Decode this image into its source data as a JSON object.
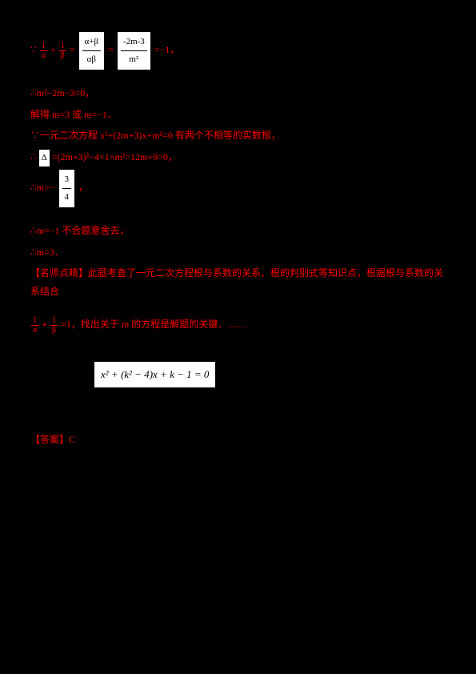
{
  "line1_prefix": "∵",
  "frac1_num": "1",
  "frac1_den": "α",
  "plus": "+",
  "frac2_num": "1",
  "frac2_den": "β",
  "eq": "=",
  "frac3a_num": "α+β",
  "frac3a_den": "αβ",
  "frac3b_num": "-2m-3",
  "frac3b_den": "m²",
  "line1_suffix": "=−1，",
  "line2": "∴m²−2m−3=0，",
  "line3": "解得 m=3 或 m=−1．",
  "line4": "∵一元二次方程 x²+(2m+3)x+m²=0 有两个不相等的实数根，",
  "line5_prefix": "∴",
  "delta_label": "Δ",
  "line5_suffix": "=(2m+3)²−4×1×m²=12m+9>0，",
  "line6_prefix": "∴m>−",
  "frac4_num": "3",
  "frac4_den": "4",
  "line6_suffix": "，",
  "line7": "∴m=−1 不合题意舍去，",
  "line8": "∴m=3．",
  "line9": "【名师点睛】此题考查了一元二次方程根与系数的关系、根的判别式等知识点，根据根与系数的关系结合",
  "frac5_num": "1",
  "frac5_den": "α",
  "frac6_num": "1",
  "frac6_den": "β",
  "line10_suffix": "=1，找出关于 m 的方程是解题的关键．……",
  "equation_box": "x² + (k² − 4)x + k − 1 = 0",
  "answer": "【答案】C"
}
